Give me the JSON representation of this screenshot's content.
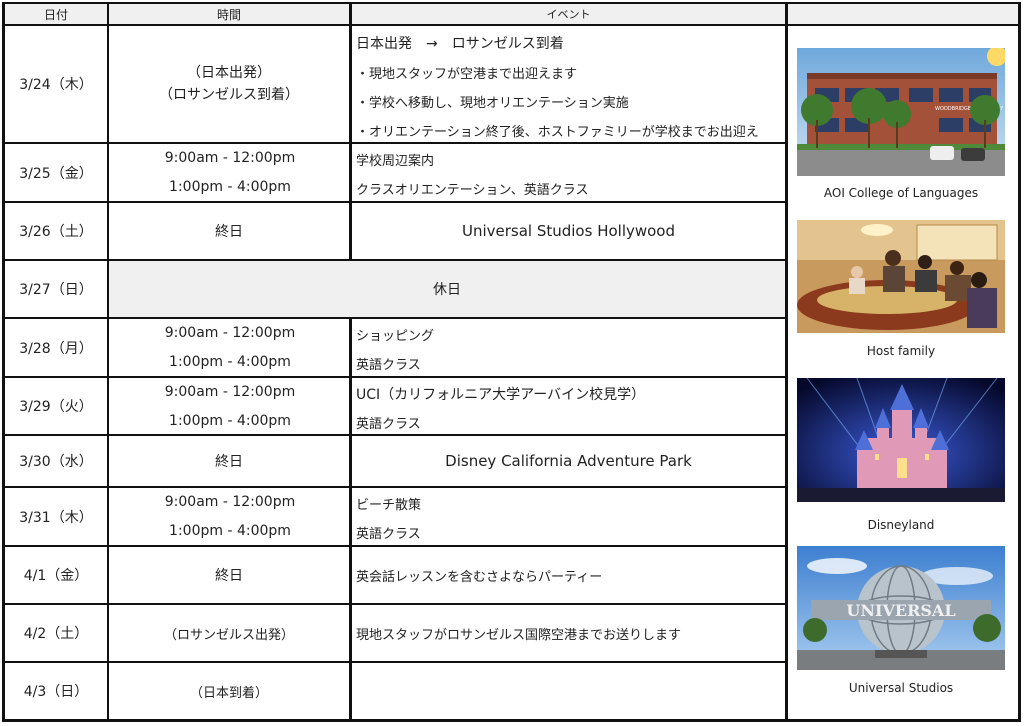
{
  "headers": {
    "date": "日付",
    "time": "時間",
    "event": "イベント",
    "photo": ""
  },
  "rows": [
    {
      "date": "3/24（木）",
      "time_lines": [
        "（日本出発）",
        "（ロサンゼルス到着）"
      ],
      "event_lines": [
        "日本出発　→　ロサンゼルス到着",
        "・現地スタッフが空港まで出迎えます",
        "・学校へ移動し、現地オリエンテーション実施",
        "・オリエンテーション終了後、ホストファミリーが学校までお出迎え"
      ]
    },
    {
      "date": "3/25（金）",
      "time_lines": [
        "9:00am - 12:00pm",
        "1:00pm - 4:00pm"
      ],
      "event_lines": [
        "学校周辺案内",
        "クラスオリエンテーション、英語クラス"
      ]
    },
    {
      "date": "3/26（土）",
      "time_lines": [
        "終日"
      ],
      "event_center": "Universal Studios Hollywood"
    },
    {
      "date": "3/27（日）",
      "merged": "休日"
    },
    {
      "date": "3/28（月）",
      "time_lines": [
        "9:00am - 12:00pm",
        "1:00pm - 4:00pm"
      ],
      "event_lines": [
        "ショッピング",
        "英語クラス"
      ]
    },
    {
      "date": "3/29（火）",
      "time_lines": [
        "9:00am - 12:00pm",
        "1:00pm - 4:00pm"
      ],
      "event_lines": [
        "UCI（カリフォルニア大学アーバイン校見学）",
        "英語クラス"
      ]
    },
    {
      "date": "3/30（水）",
      "time_lines": [
        "終日"
      ],
      "event_center": "Disney California Adventure Park"
    },
    {
      "date": "3/31（木）",
      "time_lines": [
        "9:00am - 12:00pm",
        "1:00pm - 4:00pm"
      ],
      "event_lines": [
        "ビーチ散策",
        "英語クラス"
      ]
    },
    {
      "date": "4/1（金）",
      "time_lines": [
        "終日"
      ],
      "event_lines": [
        "英会話レッスンを含むさよならパーティー"
      ]
    },
    {
      "date": "4/2（土）",
      "time_lines": [
        "（ロサンゼルス出発）"
      ],
      "event_lines": [
        "現地スタッフがロサンゼルス国際空港までお送りします"
      ]
    },
    {
      "date": "4/3（日）",
      "time_lines": [
        "（日本到着）"
      ],
      "event_lines": []
    }
  ],
  "photos": [
    {
      "caption": "AOI College of Languages",
      "sign": "WOODBRIDGE OPTOMETRY"
    },
    {
      "caption": "Host family"
    },
    {
      "caption": "Disneyland"
    },
    {
      "caption": "Universal Studios",
      "sign": "UNIVERSAL"
    }
  ]
}
